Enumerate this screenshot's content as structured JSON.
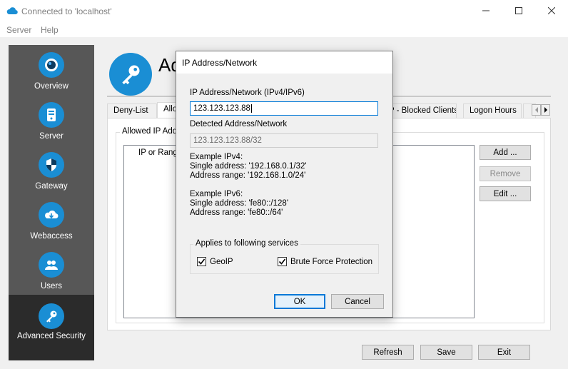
{
  "window": {
    "title": "Connected to 'localhost'"
  },
  "menu": {
    "items": [
      "Server",
      "Help"
    ]
  },
  "sidebar": {
    "items": [
      {
        "label": "Overview",
        "icon": "overview-icon"
      },
      {
        "label": "Server",
        "icon": "server-icon"
      },
      {
        "label": "Gateway",
        "icon": "gateway-icon"
      },
      {
        "label": "Webaccess",
        "icon": "webaccess-icon"
      },
      {
        "label": "Users",
        "icon": "users-icon"
      },
      {
        "label": "Advanced Security",
        "icon": "key-icon",
        "active": true
      }
    ]
  },
  "header": {
    "title": "Ad"
  },
  "tabs": {
    "items": [
      "Deny-List",
      "Allo",
      "P - Blocked Clients",
      "Logon Hours"
    ]
  },
  "panel": {
    "group_label": "Allowed  IP Add",
    "list_header": "IP or Rang",
    "add_button": "Add ...",
    "remove_button": "Remove",
    "edit_button": "Edit ..."
  },
  "footer": {
    "refresh": "Refresh",
    "save": "Save",
    "exit": "Exit"
  },
  "dialog": {
    "title": "IP Address/Network",
    "ip_label": "IP Address/Network (IPv4/IPv6)",
    "ip_value": "123.123.123.88",
    "detected_label": "Detected Address/Network",
    "detected_value": "123.123.123.88/32",
    "ipv4_title": "Example IPv4:",
    "ipv4_single": "Single address: '192.168.0.1/32'",
    "ipv4_range": "Address range: '192.168.1.0/24'",
    "ipv6_title": "Example IPv6:",
    "ipv6_single": "Single address: 'fe80::/128'",
    "ipv6_range": "Address range: 'fe80::/64'",
    "services_label": "Applies to following services",
    "geoip": {
      "label": "GeoIP",
      "checked": true
    },
    "bruteforce": {
      "label": "Brute Force Protection",
      "checked": true
    },
    "ok": "OK",
    "cancel": "Cancel"
  },
  "colors": {
    "accent": "#1a8ed4",
    "sidebar": "#575757",
    "sidebar_active": "#2b2b2b"
  }
}
